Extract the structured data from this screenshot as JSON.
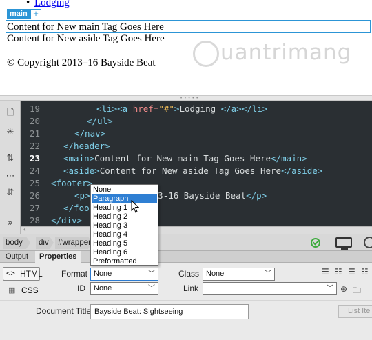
{
  "live_view": {
    "nav_link": "Lodging",
    "main_tag_label": "main",
    "main_plus": "+",
    "main_text": "Content for New main Tag Goes Here",
    "aside_text": "Content for New aside Tag Goes Here",
    "footer_text": "© Copyright 2013–16 Bayside Beat",
    "watermark": "uantrimang"
  },
  "code_view": {
    "line_numbers": [
      "19",
      "20",
      "21",
      "22",
      "23",
      "24",
      "25",
      "26",
      "27",
      "28"
    ],
    "active_line": "23",
    "lines": {
      "l19_indent": "        ",
      "l19_li_open": "<li>",
      "l19_a_open": "<a ",
      "l19_href_attr": "href=",
      "l19_href_val": "\"#\"",
      "l19_a_close_bracket": ">",
      "l19_text": "Lodging ",
      "l19_close": "</a></li>",
      "l20": "</ul>",
      "l21": "</nav>",
      "l22": "</header>",
      "l23_open": "<main>",
      "l23_text": "Content for New main Tag Goes Here",
      "l23_close": "</main>",
      "l24_open": "<aside>",
      "l24_text": "Content for New aside Tag Goes Here",
      "l24_close": "</aside>",
      "l25": "<footer>",
      "l26_open": "<p>",
      "l26_text": "2013-16 Bayside Beat",
      "l26_close": "</p>",
      "l27": "</foo",
      "l28": "</div>"
    }
  },
  "tag_selector": {
    "crumbs": [
      "body",
      "div",
      "#wrapper"
    ]
  },
  "panel_tabs": {
    "output": "Output",
    "properties": "Properties"
  },
  "properties": {
    "html_button": "HTML",
    "css_button": "CSS",
    "format_label": "Format",
    "format_value": "None",
    "id_label": "ID",
    "id_value": "None",
    "class_label": "Class",
    "class_value": "None",
    "link_label": "Link",
    "link_value": "",
    "document_title_label": "Document Title",
    "document_title_value": "Bayside Beat: Sightseeing",
    "list_item_button": "List Ite"
  },
  "format_dropdown": {
    "options": [
      "None",
      "Paragraph",
      "Heading 1",
      "Heading 2",
      "Heading 3",
      "Heading 4",
      "Heading 5",
      "Heading 6",
      "Preformatted"
    ],
    "highlighted": "Paragraph"
  },
  "colors": {
    "editor_bg": "#2a2f33",
    "tag": "#7fcfe8",
    "attribute": "#f08a8a",
    "string": "#f3bf5a",
    "accent": "#2c95d6",
    "selection": "#2f7fd3"
  }
}
